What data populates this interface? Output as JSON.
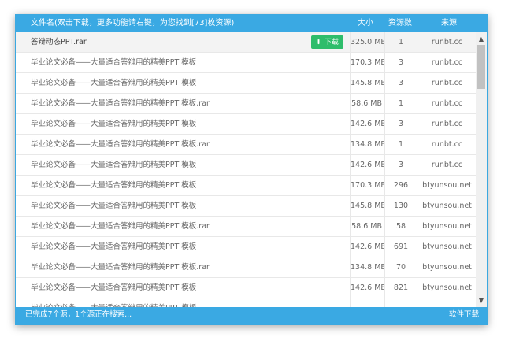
{
  "header": {
    "name_label": "文件名(双击下载，更多功能请右键，为您找到[73]枚资源)",
    "size_label": "大小",
    "count_label": "资源数",
    "source_label": "来源"
  },
  "download_label": "下载",
  "rows": [
    {
      "name": "答辩动态PPT.rar",
      "size": "325.0 MB",
      "count": "1",
      "source": "runbt.cc"
    },
    {
      "name": "毕业论文必备——大量适合答辩用的精美PPT 模板",
      "size": "170.3 MB",
      "count": "3",
      "source": "runbt.cc"
    },
    {
      "name": "毕业论文必备——大量适合答辩用的精美PPT 模板",
      "size": "145.8 MB",
      "count": "3",
      "source": "runbt.cc"
    },
    {
      "name": "毕业论文必备——大量适合答辩用的精美PPT 模板.rar",
      "size": "58.6 MB",
      "count": "1",
      "source": "runbt.cc"
    },
    {
      "name": "毕业论文必备——大量适合答辩用的精美PPT 模板",
      "size": "142.6 MB",
      "count": "3",
      "source": "runbt.cc"
    },
    {
      "name": "毕业论文必备——大量适合答辩用的精美PPT 模板.rar",
      "size": "134.8 MB",
      "count": "1",
      "source": "runbt.cc"
    },
    {
      "name": "毕业论文必备——大量适合答辩用的精美PPT 模板",
      "size": "142.6 MB",
      "count": "3",
      "source": "runbt.cc"
    },
    {
      "name": "毕业论文必备——大量适合答辩用的精美PPT 模板",
      "size": "170.3 MB",
      "count": "296",
      "source": "btyunsou.net"
    },
    {
      "name": "毕业论文必备——大量适合答辩用的精美PPT 模板",
      "size": "145.8 MB",
      "count": "130",
      "source": "btyunsou.net"
    },
    {
      "name": "毕业论文必备——大量适合答辩用的精美PPT 模板.rar",
      "size": "58.6 MB",
      "count": "58",
      "source": "btyunsou.net"
    },
    {
      "name": "毕业论文必备——大量适合答辩用的精美PPT 模板",
      "size": "142.6 MB",
      "count": "691",
      "source": "btyunsou.net"
    },
    {
      "name": "毕业论文必备——大量适合答辩用的精美PPT 模板.rar",
      "size": "134.8 MB",
      "count": "70",
      "source": "btyunsou.net"
    },
    {
      "name": "毕业论文必备——大量适合答辩用的精美PPT 模板",
      "size": "142.6 MB",
      "count": "821",
      "source": "btyunsou.net"
    },
    {
      "name": "毕业论文必备——大量适合答辩用的精美PPT 模板",
      "size": "",
      "count": "",
      "source": ""
    }
  ],
  "footer": {
    "status": "已完成7个源，1个源正在搜索...",
    "link": "软件下载"
  },
  "icons": {
    "download": "download-arrow-icon",
    "scroll_up": "chevron-up-icon",
    "scroll_down": "chevron-down-icon"
  },
  "colors": {
    "header_bg": "#3aa9e3",
    "download_btn": "#2ebd6b"
  }
}
